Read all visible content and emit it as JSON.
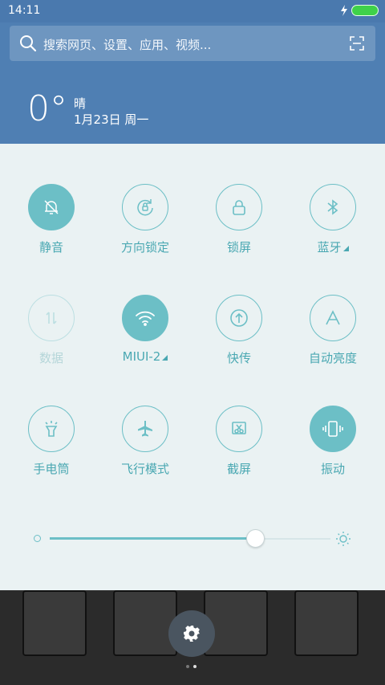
{
  "status": {
    "time": "14:11",
    "battery_icon": "battery-charging-icon"
  },
  "search": {
    "placeholder": "搜索网页、设置、应用、视频..."
  },
  "weather": {
    "temp": "0°",
    "condition": "晴",
    "date": "1月23日 周一"
  },
  "colors": {
    "accent": "#6cbfc6",
    "panel": "#eaf2f3",
    "background": "#4f7fb3"
  },
  "tiles": [
    {
      "label": "静音",
      "icon": "bell-off-icon",
      "state": "on"
    },
    {
      "label": "方向锁定",
      "icon": "rotation-lock-icon",
      "state": "off"
    },
    {
      "label": "锁屏",
      "icon": "lock-icon",
      "state": "off"
    },
    {
      "label": "蓝牙",
      "icon": "bluetooth-icon",
      "state": "off"
    },
    {
      "label": "数据",
      "icon": "mobile-data-icon",
      "state": "disabled"
    },
    {
      "label": "MIUI-2",
      "icon": "wifi-icon",
      "state": "on"
    },
    {
      "label": "快传",
      "icon": "transfer-icon",
      "state": "off"
    },
    {
      "label": "自动亮度",
      "icon": "auto-brightness-icon",
      "state": "off"
    },
    {
      "label": "手电筒",
      "icon": "flashlight-icon",
      "state": "off"
    },
    {
      "label": "飞行模式",
      "icon": "airplane-icon",
      "state": "off"
    },
    {
      "label": "截屏",
      "icon": "screenshot-icon",
      "state": "off"
    },
    {
      "label": "振动",
      "icon": "vibrate-icon",
      "state": "on"
    }
  ],
  "brightness": {
    "level": 0.73
  },
  "dock": {
    "apps": [
      "phone-icon",
      "browser-icon",
      "messages-icon",
      "camera-icon"
    ]
  },
  "page_indicator": {
    "pages": 2,
    "current": 2
  }
}
